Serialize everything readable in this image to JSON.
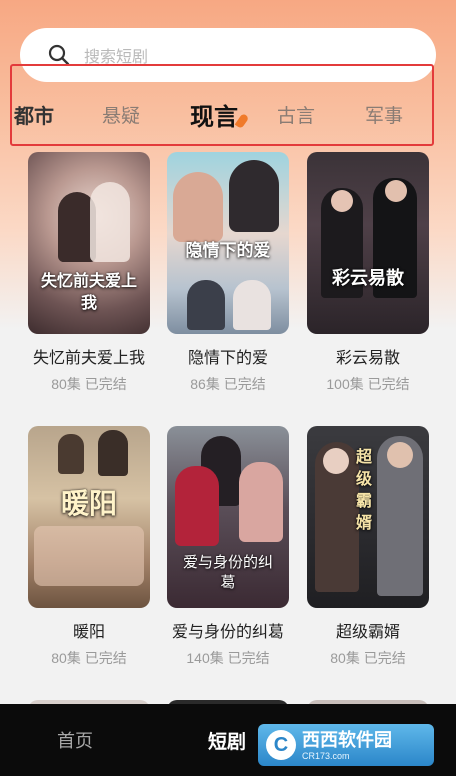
{
  "search": {
    "placeholder": "搜索短剧"
  },
  "tabs": [
    {
      "label": "都市"
    },
    {
      "label": "悬疑"
    },
    {
      "label": "现言"
    },
    {
      "label": "古言"
    },
    {
      "label": "军事"
    }
  ],
  "dramas": [
    {
      "title": "失忆前夫爱上我",
      "poster_text": "失忆前夫爱上我",
      "meta": "80集 已完结"
    },
    {
      "title": "隐情下的爱",
      "poster_text": "隐情下的爱",
      "meta": "86集 已完结"
    },
    {
      "title": "彩云易散",
      "poster_text": "彩云易散",
      "meta": "100集 已完结"
    },
    {
      "title": "暖阳",
      "poster_text": "暖阳",
      "meta": "80集 已完结"
    },
    {
      "title": "爱与身份的纠葛",
      "poster_text": "爱与身份的纠葛",
      "meta": "140集 已完结"
    },
    {
      "title": "超级霸婿",
      "poster_text": "超级霸婿",
      "meta": "80集 已完结"
    }
  ],
  "bottom_nav": {
    "home": "首页",
    "shorts": "短剧"
  },
  "watermark": {
    "brand": "西西软件园",
    "domain": "CR173.com"
  },
  "colors": {
    "accent": "#f07a2a",
    "highlight_box": "#e33b3b",
    "nav_bg": "#0b0b0b"
  }
}
